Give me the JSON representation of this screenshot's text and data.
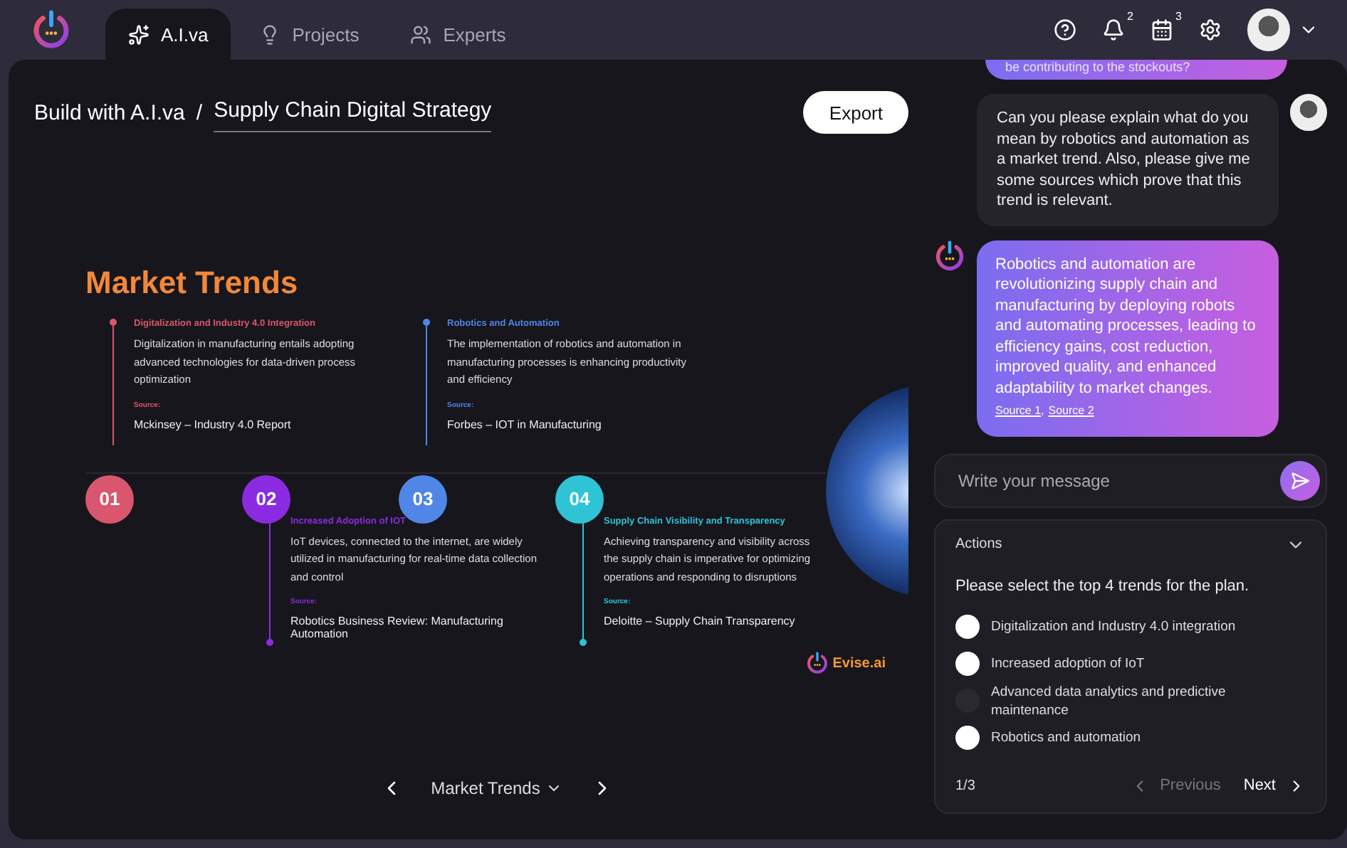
{
  "nav": {
    "tabs": [
      {
        "label": "A.I.va",
        "selected": true
      },
      {
        "label": "Projects",
        "selected": false
      },
      {
        "label": "Experts",
        "selected": false
      }
    ],
    "notifications_badge": "2",
    "calendar_badge": "3"
  },
  "header": {
    "breadcrumb": "Build with A.I.va",
    "separator": "/",
    "project_name": "Supply Chain Digital Strategy",
    "export_button": "Export"
  },
  "slide": {
    "title": "Market Trends",
    "brand": "Evise.ai",
    "trends": [
      {
        "number": "01",
        "color": "#d9566e",
        "title": "Digitalization and Industry 4.0 Integration",
        "text": "Digitalization in manufacturing entails adopting advanced technologies for data-driven process optimization",
        "source_label": "Source:",
        "source": "Mckinsey – Industry 4.0 Report"
      },
      {
        "number": "02",
        "color": "#8a2be2",
        "title": "Increased Adoption of IOT",
        "text": "IoT devices, connected to the internet, are widely utilized in manufacturing for real-time data collection and control",
        "source_label": "Source:",
        "source": "Robotics Business Review: Manufacturing Automation"
      },
      {
        "number": "03",
        "color": "#4f86e8",
        "title": "Robotics and Automation",
        "text": "The implementation of robotics and automation in manufacturing processes is enhancing productivity and efficiency",
        "source_label": "Source:",
        "source": "Forbes – IOT in Manufacturing"
      },
      {
        "number": "04",
        "color": "#2ec4d6",
        "title": "Supply Chain Visibility and Transparency",
        "text": "Achieving transparency and visibility across the supply chain is imperative for optimizing operations and responding to disruptions",
        "source_label": "Source:",
        "source": "Deloitte – Supply Chain Transparency"
      }
    ]
  },
  "pager": {
    "label": "Market Trends"
  },
  "chat": {
    "messages": [
      {
        "kind": "ai-cut",
        "text": "be contributing to the stockouts?"
      },
      {
        "kind": "user",
        "text": "Can you please explain what do you mean by robotics and automation as a market trend. Also, please give me some sources which prove that this trend is relevant."
      },
      {
        "kind": "ai",
        "text": "Robotics and automation are revolutionizing supply chain and manufacturing by deploying robots and automating processes, leading to efficiency gains, cost reduction, improved quality, and enhanced adaptability to market changes.",
        "links": [
          "Source 1",
          "Source 2"
        ],
        "link_separator": ","
      }
    ],
    "input": {
      "placeholder": "Write your message"
    }
  },
  "actions": {
    "title": "Actions",
    "question": "Please select the top 4 trends for the plan.",
    "options": [
      {
        "label": "Digitalization and Industry 4.0 integration",
        "checked": false,
        "disabled": false
      },
      {
        "label": "Increased adoption of IoT",
        "checked": false,
        "disabled": false
      },
      {
        "label": "Advanced data analytics and predictive maintenance",
        "checked": false,
        "disabled": true
      },
      {
        "label": "Robotics and automation",
        "checked": false,
        "disabled": false
      }
    ],
    "page": "1/3",
    "previous": {
      "label": "Previous",
      "disabled": true
    },
    "next": {
      "label": "Next",
      "disabled": false
    }
  }
}
